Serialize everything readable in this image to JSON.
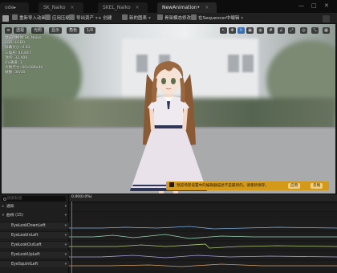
{
  "tabs": [
    {
      "label": "ode▸",
      "active": false
    },
    {
      "label": "SK_Naiko",
      "active": false
    },
    {
      "label": "SKEL_Naiko",
      "active": false
    },
    {
      "label": "NewAnimation•",
      "active": true
    }
  ],
  "toolbar": {
    "items": [
      {
        "label": "重新导入动画",
        "icon": "reimport-icon"
      },
      {
        "label": "应用压缩",
        "icon": "compress-icon"
      },
      {
        "label": "导出资产",
        "icon": "export-icon"
      },
      {
        "label": "+ 创建"
      },
      {
        "label": "新的图表",
        "icon": "graph-icon"
      },
      {
        "label": "骨架模态修改",
        "icon": "bone-icon"
      },
      {
        "label": "在Sequencer中编辑",
        "icon": "sequencer-icon"
      }
    ]
  },
  "viewport": {
    "buttons": [
      "透视",
      "光照",
      "显示",
      "角色",
      "1/4"
    ],
    "stats": [
      "预览网格体:SK_Naiko",
      "LOD: LOD0",
      "屏幕大小: 0.83",
      "三角形: 46,847",
      "顶点: 32,409",
      "UV通道: 1",
      "大致尺寸: 60x188x40",
      "帧数: 30/30"
    ]
  },
  "banner": {
    "text": "预览场景设置中的编辑器描述不是最新的。请重新保存。",
    "btn1": "应用",
    "btn2": "忽略"
  },
  "sequencer": {
    "search_placeholder": "搜索轨道",
    "time": "0.00(0.0%)",
    "groups": [
      "通知",
      "曲线  (15)"
    ],
    "curves": [
      "EyeLookDownLeft",
      "EyeLookInLeft",
      "EyeLookOutLeft",
      "EyeLookUpLeft",
      "EyeSquintLeft"
    ],
    "curve_colors": [
      "#7fb0e0",
      "#9cd6b9",
      "#b0c97a",
      "#a8a4dc",
      "#d4a06c"
    ]
  }
}
